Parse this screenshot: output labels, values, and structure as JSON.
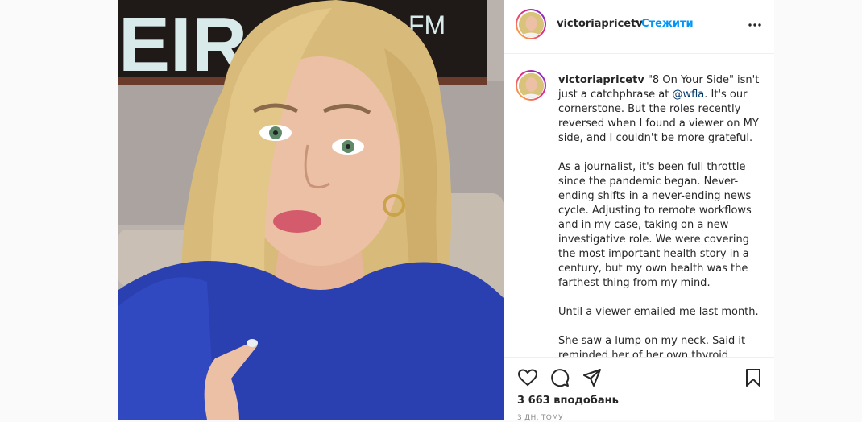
{
  "post": {
    "username": "victoriapricetv",
    "separator": "•",
    "follow_label": "Стежити",
    "more_icon": "more-horizontal-icon",
    "sign_text": "EIRA",
    "sign_text_right": "FM"
  },
  "caption": {
    "username": "victoriapricetv",
    "p1_a": "\"8 On Your Side\" isn't just a catchphrase at ",
    "mention": "@wfla",
    "p1_b": ". It's our cornerstone. But the roles recently reversed when I found a viewer on MY side, and I couldn't be more grateful.",
    "p2": "As a journalist, it's been full throttle since the pandemic began. Never-ending shifts in a never-ending news cycle. Adjusting to remote workflows and in my case, taking on a new investigative role. We were covering the most important health story in a century, but my own health was the farthest thing from my mind.",
    "p3": "Until a viewer emailed me last month.",
    "p4": "She saw a lump on my neck. Said it reminded her of her own thyroid cancer."
  },
  "footer": {
    "likes": "3 663 вподобань",
    "time": "3 дн. тому"
  },
  "colors": {
    "accent": "#0095f6",
    "mention": "#00376b",
    "text": "#262626",
    "secondary": "#8e8e8e"
  }
}
